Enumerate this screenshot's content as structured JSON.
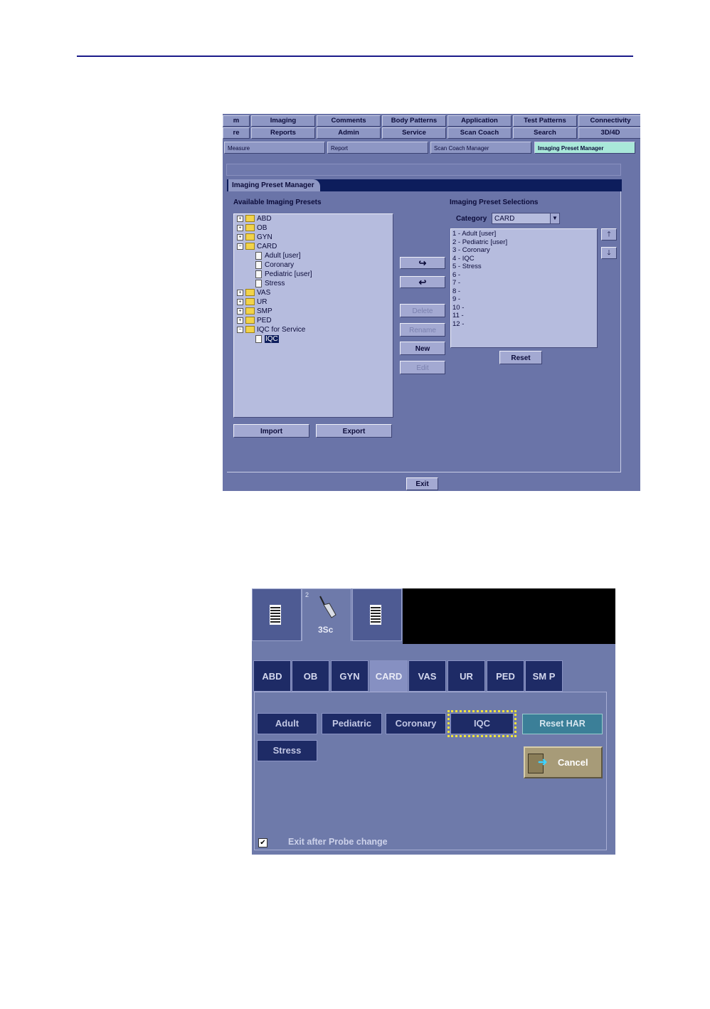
{
  "screen1": {
    "top_tabs_row1": [
      "m",
      "Imaging",
      "Comments",
      "Body Patterns",
      "Application",
      "Test Patterns",
      "Connectivity"
    ],
    "top_tabs_row2": [
      "re",
      "Reports",
      "Admin",
      "Service",
      "Scan Coach",
      "Search",
      "3D/4D"
    ],
    "sub_tabs": [
      "Measure",
      "Report",
      "Scan Coach Manager",
      "Imaging Preset Manager"
    ],
    "active_sub_tab": "Imaging Preset Manager",
    "panel_title": "Imaging Preset Manager",
    "available_label": "Available Imaging Presets",
    "tree": {
      "abd": "ABD",
      "ob": "OB",
      "gyn": "GYN",
      "card": "CARD",
      "card_adult": "Adult [user]",
      "card_coronary": "Coronary",
      "card_pediatric": "Pediatric [user]",
      "card_stress": "Stress",
      "vas": "VAS",
      "ur": "UR",
      "smp": "SMP",
      "ped": "PED",
      "iqc_service": "IQC for Service",
      "iqc": "IQC"
    },
    "buttons": {
      "move_right": "↪",
      "move_left": "↩",
      "delete": "Delete",
      "rename": "Rename",
      "new": "New",
      "edit": "Edit",
      "import": "Import",
      "export": "Export",
      "reset": "Reset",
      "exit": "Exit",
      "up": "🡑",
      "down": "🡓"
    },
    "selections_label": "Imaging Preset Selections",
    "category_label": "Category",
    "category_value": "CARD",
    "selections": [
      "1 - Adult [user]",
      "2 - Pediatric [user]",
      "3 - Coronary",
      "4 - IQC",
      "5 - Stress",
      "6 -",
      "7 -",
      "8 -",
      "9 -",
      "10 -",
      "11 -",
      "12 -"
    ]
  },
  "screen2": {
    "probe_port_number": "2",
    "probe_name": "3Sc",
    "categories": [
      "ABD",
      "OB",
      "GYN",
      "CARD",
      "VAS",
      "UR",
      "PED",
      "SM P"
    ],
    "active_category": "CARD",
    "presets": [
      "Adult",
      "Pediatric",
      "Coronary",
      "IQC",
      "Stress"
    ],
    "selected_preset": "IQC",
    "reset_har": "Reset HAR",
    "cancel": "Cancel",
    "exit_after_probe_change": "Exit after Probe change",
    "checkbox_mark": "✔"
  }
}
